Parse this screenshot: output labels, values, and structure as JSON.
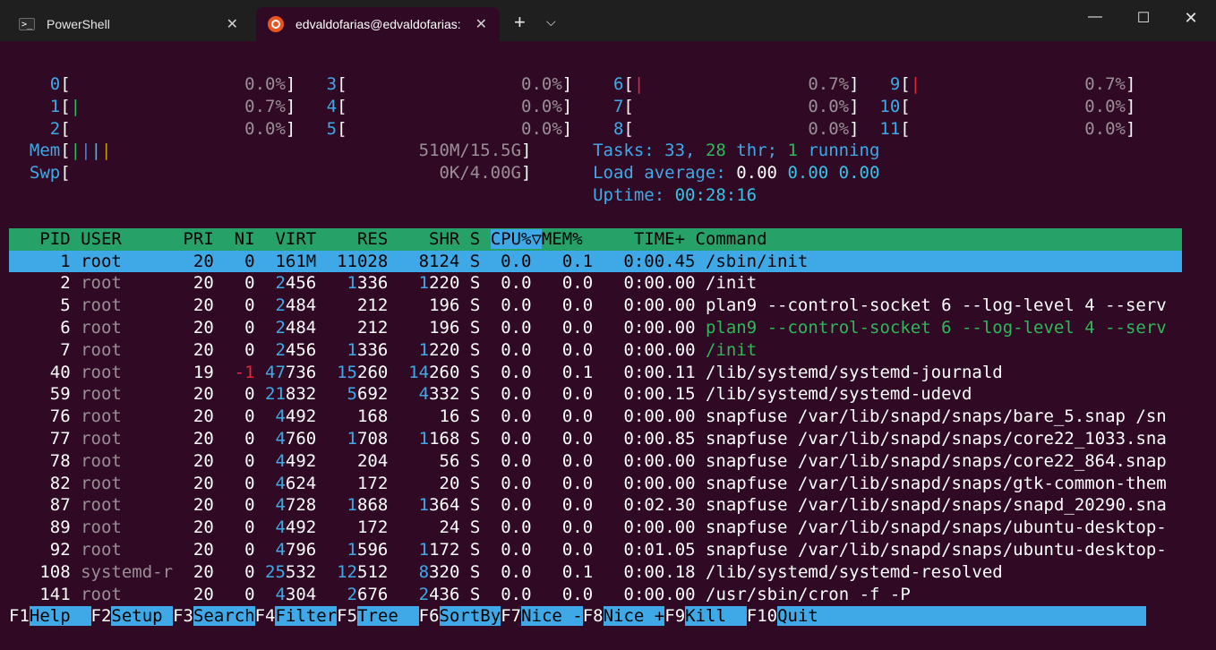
{
  "window": {
    "tabs": [
      {
        "label": "PowerShell",
        "icon": "powershell-icon",
        "active": false
      },
      {
        "label": "edvaldofarias@edvaldofarias:",
        "icon": "ubuntu-icon",
        "active": true
      }
    ],
    "new_tab": "+",
    "dropdown": "⌵",
    "minimize": "—",
    "maximize": "☐",
    "close": "✕",
    "tab_close": "✕"
  },
  "cpus": [
    {
      "id": "0",
      "bar": "",
      "value": "0.0%"
    },
    {
      "id": "1",
      "bar": "|",
      "value": "0.7%"
    },
    {
      "id": "2",
      "bar": "",
      "value": "0.0%"
    },
    {
      "id": "3",
      "bar": "",
      "value": "0.0%"
    },
    {
      "id": "4",
      "bar": "",
      "value": "0.0%"
    },
    {
      "id": "5",
      "bar": "",
      "value": "0.0%"
    },
    {
      "id": "6",
      "bar": "|",
      "value": "0.7%"
    },
    {
      "id": "7",
      "bar": "",
      "value": "0.0%"
    },
    {
      "id": "8",
      "bar": "",
      "value": "0.0%"
    },
    {
      "id": "9",
      "bar": "|",
      "value": "0.7%"
    },
    {
      "id": "10",
      "bar": "",
      "value": "0.0%"
    },
    {
      "id": "11",
      "bar": "",
      "value": "0.0%"
    }
  ],
  "mem": {
    "label": "Mem",
    "value": "510M/15.5G"
  },
  "swp": {
    "label": "Swp",
    "value": "0K/4.00G"
  },
  "tasks": {
    "label": "Tasks:",
    "count": "33,",
    "thr": "28",
    "thr_label": "thr;",
    "running": "1",
    "running_label": "running"
  },
  "load": {
    "label": "Load average:",
    "l1": "0.00",
    "l5": "0.00",
    "l15": "0.00"
  },
  "uptime": {
    "label": "Uptime:",
    "value": "00:28:16"
  },
  "columns": [
    "PID",
    "USER",
    "PRI",
    "NI",
    "VIRT",
    "RES",
    "SHR",
    "S",
    "CPU%▽",
    "MEM%",
    "TIME+",
    "Command"
  ],
  "processes": [
    {
      "pid": "1",
      "user": "root",
      "pri": "20",
      "ni": "0",
      "virt": "161M",
      "res": "11028",
      "shr": "8124",
      "s": "S",
      "cpu": "0.0",
      "mem": "0.1",
      "time": "0:00.45",
      "cmd": "/sbin/init"
    },
    {
      "pid": "2",
      "user": "root",
      "pri": "20",
      "ni": "0",
      "virt": "2456",
      "res": "1336",
      "shr": "1220",
      "s": "S",
      "cpu": "0.0",
      "mem": "0.0",
      "time": "0:00.00",
      "cmd": "/init"
    },
    {
      "pid": "5",
      "user": "root",
      "pri": "20",
      "ni": "0",
      "virt": "2484",
      "res": "212",
      "shr": "196",
      "s": "S",
      "cpu": "0.0",
      "mem": "0.0",
      "time": "0:00.00",
      "cmd": "plan9 --control-socket 6 --log-level 4 --serv"
    },
    {
      "pid": "6",
      "user": "root",
      "pri": "20",
      "ni": "0",
      "virt": "2484",
      "res": "212",
      "shr": "196",
      "s": "S",
      "cpu": "0.0",
      "mem": "0.0",
      "time": "0:00.00",
      "cmd": "plan9 --control-socket 6 --log-level 4 --serv"
    },
    {
      "pid": "7",
      "user": "root",
      "pri": "20",
      "ni": "0",
      "virt": "2456",
      "res": "1336",
      "shr": "1220",
      "s": "S",
      "cpu": "0.0",
      "mem": "0.0",
      "time": "0:00.00",
      "cmd": "/init"
    },
    {
      "pid": "40",
      "user": "root",
      "pri": "19",
      "ni": "-1",
      "virt": "47736",
      "res": "15260",
      "shr": "14260",
      "s": "S",
      "cpu": "0.0",
      "mem": "0.1",
      "time": "0:00.11",
      "cmd": "/lib/systemd/systemd-journald"
    },
    {
      "pid": "59",
      "user": "root",
      "pri": "20",
      "ni": "0",
      "virt": "21832",
      "res": "5692",
      "shr": "4332",
      "s": "S",
      "cpu": "0.0",
      "mem": "0.0",
      "time": "0:00.15",
      "cmd": "/lib/systemd/systemd-udevd"
    },
    {
      "pid": "76",
      "user": "root",
      "pri": "20",
      "ni": "0",
      "virt": "4492",
      "res": "168",
      "shr": "16",
      "s": "S",
      "cpu": "0.0",
      "mem": "0.0",
      "time": "0:00.00",
      "cmd": "snapfuse /var/lib/snapd/snaps/bare_5.snap /sn"
    },
    {
      "pid": "77",
      "user": "root",
      "pri": "20",
      "ni": "0",
      "virt": "4760",
      "res": "1708",
      "shr": "1168",
      "s": "S",
      "cpu": "0.0",
      "mem": "0.0",
      "time": "0:00.85",
      "cmd": "snapfuse /var/lib/snapd/snaps/core22_1033.sna"
    },
    {
      "pid": "78",
      "user": "root",
      "pri": "20",
      "ni": "0",
      "virt": "4492",
      "res": "204",
      "shr": "56",
      "s": "S",
      "cpu": "0.0",
      "mem": "0.0",
      "time": "0:00.00",
      "cmd": "snapfuse /var/lib/snapd/snaps/core22_864.snap"
    },
    {
      "pid": "82",
      "user": "root",
      "pri": "20",
      "ni": "0",
      "virt": "4624",
      "res": "172",
      "shr": "20",
      "s": "S",
      "cpu": "0.0",
      "mem": "0.0",
      "time": "0:00.00",
      "cmd": "snapfuse /var/lib/snapd/snaps/gtk-common-them"
    },
    {
      "pid": "87",
      "user": "root",
      "pri": "20",
      "ni": "0",
      "virt": "4728",
      "res": "1868",
      "shr": "1364",
      "s": "S",
      "cpu": "0.0",
      "mem": "0.0",
      "time": "0:02.30",
      "cmd": "snapfuse /var/lib/snapd/snaps/snapd_20290.sna"
    },
    {
      "pid": "89",
      "user": "root",
      "pri": "20",
      "ni": "0",
      "virt": "4492",
      "res": "172",
      "shr": "24",
      "s": "S",
      "cpu": "0.0",
      "mem": "0.0",
      "time": "0:00.00",
      "cmd": "snapfuse /var/lib/snapd/snaps/ubuntu-desktop-"
    },
    {
      "pid": "92",
      "user": "root",
      "pri": "20",
      "ni": "0",
      "virt": "4796",
      "res": "1596",
      "shr": "1172",
      "s": "S",
      "cpu": "0.0",
      "mem": "0.0",
      "time": "0:01.05",
      "cmd": "snapfuse /var/lib/snapd/snaps/ubuntu-desktop-"
    },
    {
      "pid": "108",
      "user": "systemd-r",
      "pri": "20",
      "ni": "0",
      "virt": "25532",
      "res": "12512",
      "shr": "8320",
      "s": "S",
      "cpu": "0.0",
      "mem": "0.1",
      "time": "0:00.18",
      "cmd": "/lib/systemd/systemd-resolved"
    },
    {
      "pid": "141",
      "user": "root",
      "pri": "20",
      "ni": "0",
      "virt": "4304",
      "res": "2676",
      "shr": "2436",
      "s": "S",
      "cpu": "0.0",
      "mem": "0.0",
      "time": "0:00.00",
      "cmd": "/usr/sbin/cron -f -P"
    }
  ],
  "fkeys": [
    {
      "key": "F1",
      "label": "Help  "
    },
    {
      "key": "F2",
      "label": "Setup "
    },
    {
      "key": "F3",
      "label": "Search"
    },
    {
      "key": "F4",
      "label": "Filter"
    },
    {
      "key": "F5",
      "label": "Tree  "
    },
    {
      "key": "F6",
      "label": "SortBy"
    },
    {
      "key": "F7",
      "label": "Nice -"
    },
    {
      "key": "F8",
      "label": "Nice +"
    },
    {
      "key": "F9",
      "label": "Kill  "
    },
    {
      "key": "F10",
      "label": "Quit"
    }
  ],
  "colors": {
    "background": "#300a24",
    "header": "#26a269",
    "selection": "#3fa9e8",
    "titlebar": "#1f1f1f"
  }
}
